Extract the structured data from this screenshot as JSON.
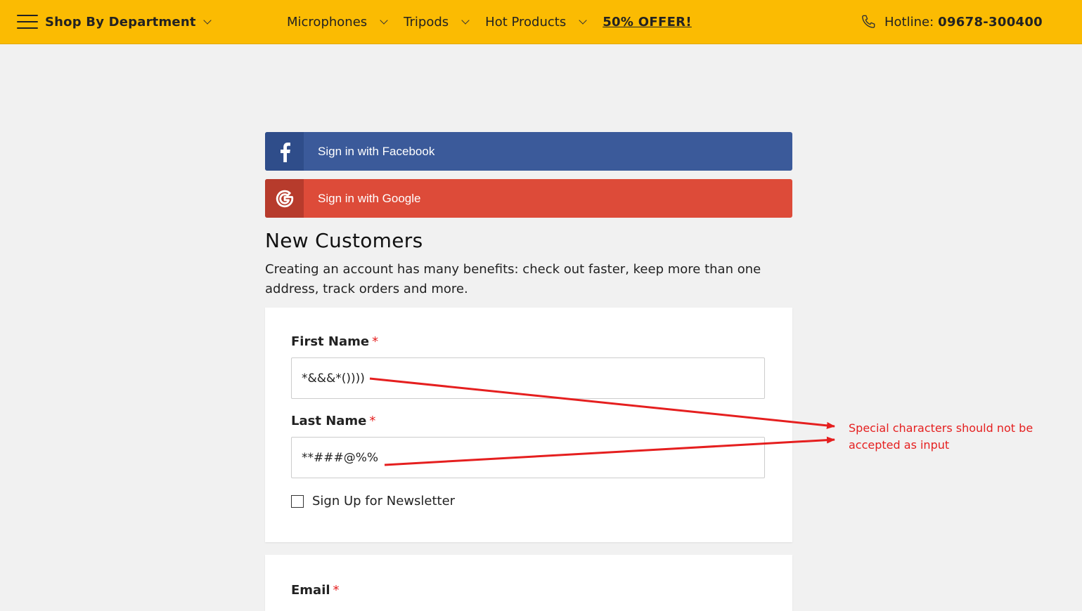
{
  "header": {
    "department_label": "Shop By Department",
    "nav": [
      {
        "label": "Microphones"
      },
      {
        "label": "Tripods"
      },
      {
        "label": "Hot Products"
      }
    ],
    "offer_label": "50% OFFER!",
    "hotline_label": "Hotline:",
    "hotline_number": "09678-300400",
    "bg_color": "#fbbb02"
  },
  "social": {
    "facebook_label": "Sign in with Facebook",
    "facebook_icon": "facebook-icon",
    "google_label": "Sign in with Google",
    "google_icon": "google-icon",
    "facebook_color": "#3b5a9a",
    "google_color": "#dd4b39"
  },
  "main": {
    "title": "New Customers",
    "intro": "Creating an account has many benefits: check out faster, keep more than one address, track orders and more."
  },
  "form": {
    "first_name_label": "First Name",
    "first_name_value": "*&&&*())))",
    "last_name_label": "Last Name",
    "last_name_value": "**###@%%",
    "required_mark": "*",
    "newsletter_label": "Sign Up for Newsletter",
    "newsletter_checked": false,
    "email_label": "Email"
  },
  "annotation": {
    "text": "Special characters should not be accepted as input",
    "color": "#e51f1f"
  }
}
